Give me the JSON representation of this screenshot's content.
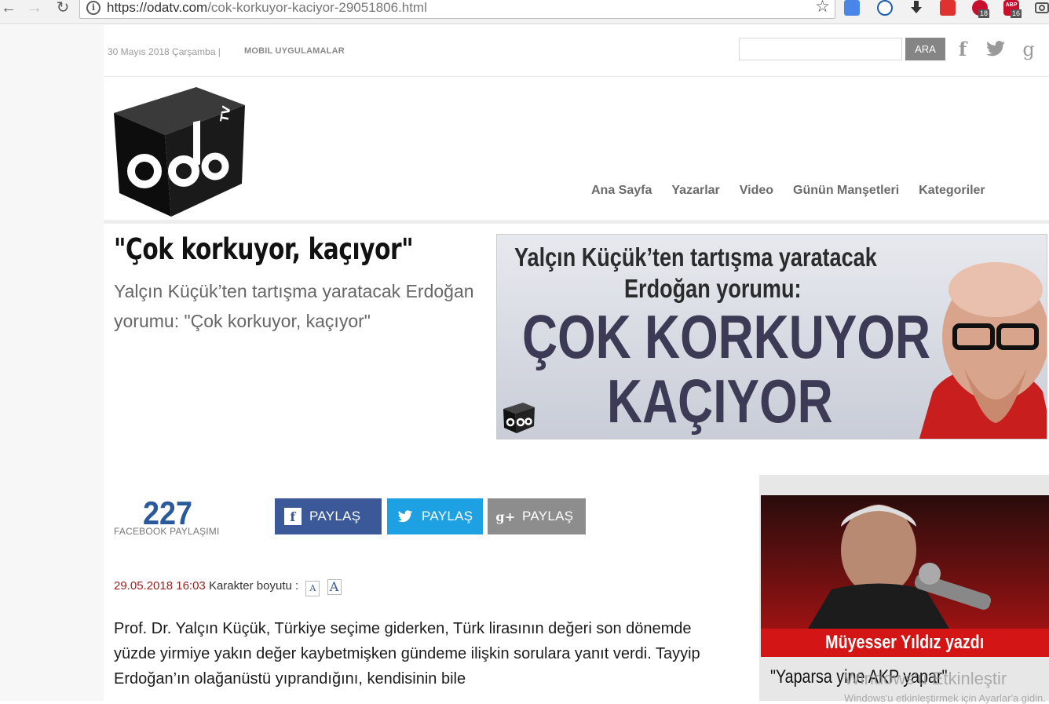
{
  "browser": {
    "url_host": "https://odatv.com",
    "url_path": "/cok-korkuyor-kaciyor-29051806.html",
    "ext_badge_1": "18",
    "ext_badge_2": "16",
    "ext_label_abp": "ABP"
  },
  "topbar": {
    "date": "30 Mayıs 2018 Çarşamba |",
    "mobile_apps": "MOBIL UYGULAMALAR",
    "search_placeholder": "",
    "search_button": "ARA"
  },
  "nav": {
    "items": [
      "Ana Sayfa",
      "Yazarlar",
      "Video",
      "Günün Manşetleri",
      "Kategoriler"
    ]
  },
  "article": {
    "title": "\"Çok korkuyor, kaçıyor\"",
    "subtitle": "Yalçın Küçük’ten tartışma yaratacak Erdoğan yorumu: \"Çok korkuyor, kaçıyor\"",
    "hero_line1": "Yalçın Küçük’ten tartışma yaratacak",
    "hero_line2": "Erdoğan yorumu:",
    "hero_line3": "ÇOK KORKUYOR",
    "hero_line4": "KAÇIYOR",
    "share_count": "227",
    "share_label": "FACEBOOK PAYLAŞIMI",
    "share_facebook": "PAYLAŞ",
    "share_twitter": "PAYLAŞ",
    "share_google": "PAYLAŞ",
    "datetime": "29.05.2018 16:03",
    "font_size_label": "Karakter boyutu :",
    "font_small": "A",
    "font_big": "A",
    "body": "Prof. Dr. Yalçın Küçük, Türkiye seçime giderken, Türk lirasının değeri son dönemde yüzde yirmiye yakın değer kaybetmişken gündeme ilişkin sorulara yanıt verdi. Tayyip Erdoğan’ın olağanüstü yıprandığını, kendisinin bile"
  },
  "sidebar": {
    "banner": "Müyesser Yıldız yazdı",
    "caption": "\"Yaparsa yine AKP yapar\""
  },
  "os_watermark": {
    "line1": "Windows'u Etkinleştir",
    "line2": "Windows'u etkinleştirmek için Ayarlar'a gidin."
  },
  "colors": {
    "facebook": "#3b5998",
    "twitter": "#1da1e2",
    "google": "#8d8d8d",
    "date_red": "#9b1d1d",
    "count_blue": "#2b5a9c",
    "banner_red": "#d41515"
  }
}
